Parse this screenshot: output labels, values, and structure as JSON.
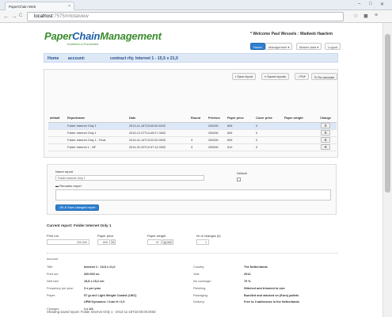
{
  "browser": {
    "tab_title": "PaperChain Web",
    "tab_close": "×",
    "url_host": "localhost",
    "url_path": ":7575/#/totalview",
    "back": "←",
    "forward": "→",
    "reload": "C",
    "win_min": "–",
    "win_max": "□",
    "win_close": "✕",
    "star": "☆",
    "ext": "◼",
    "menu": "≡"
  },
  "header": {
    "logo_paper": "Paper",
    "logo_chain": "Chain",
    "logo_management": "Management",
    "tagline": "Excellence in Procurement",
    "welcome": "* Welcome Paul Wessels : Wadweb Haarlem",
    "nav": {
      "home": "Home",
      "management": "Management ▾",
      "master_data": "Master data ▾",
      "logout": "Logout"
    }
  },
  "breadcrumb": {
    "home": "Home",
    "account": "account:",
    "contract": "contract rfq: Internet 1 - 15,5 x 21,0"
  },
  "actions": {
    "save_report": "Save report",
    "saved_reports": "Saved reports",
    "pdf": "PDF",
    "recalculate": "Re-calculate"
  },
  "reports_table": {
    "columns": [
      "default",
      "Reportname",
      "Date",
      "Round",
      "Printrun",
      "Paper price",
      "Cover price",
      "Paper weight",
      "Change"
    ],
    "rows": [
      {
        "default": "",
        "name": "Folder Internet Only 1",
        "date": "2013-11-18T23:00:00.000Z",
        "round": "",
        "printrun": "200000",
        "paper_price": "605",
        "cover_price": "0",
        "paper_weight": ""
      },
      {
        "default": "",
        "name": "Folder Internet Only 1",
        "date": "2013-12-07T14:45:27.000Z",
        "round": "",
        "printrun": "200000",
        "paper_price": "605",
        "cover_price": "0",
        "paper_weight": ""
      },
      {
        "default": "",
        "name": "Folder Internet Only 1 - Final",
        "date": "2014-01-14T13:22:00.000Z",
        "round": "3",
        "printrun": "200000",
        "paper_price": "605",
        "cover_price": "0",
        "paper_weight": ""
      },
      {
        "default": "",
        "name": "Folder Internet 1 - NF",
        "date": "2014-02-20T10:37:14.000Z",
        "round": "3",
        "printrun": "200000",
        "paper_price": "610",
        "cover_price": "0",
        "paper_weight": ""
      }
    ],
    "change_icon": "⚙"
  },
  "edit_form": {
    "name_label": "Name report",
    "name_value": "Folder Internet Only 1",
    "default_label": "Default",
    "remarks_label": "Remarks report",
    "remarks_value": "",
    "ok_button": "OK & Save changed report"
  },
  "current": {
    "label": "Current report: Folder Internet Only 1",
    "printrun_label": "Print run",
    "printrun_value": "200.000",
    "paper_price_label": "Paper price",
    "paper_price_value": "605",
    "paper_price_unit": "€",
    "paper_weight_label": "Paper weight",
    "paper_weight_value": "57",
    "paper_weight_unit": "gr./m2",
    "changes_label": "Nr of changes (it)",
    "changes_value": "1"
  },
  "details": {
    "account_label": "Account:",
    "left": [
      {
        "k": "Title:",
        "v": "Internet 1 : 15,5 x 21,0"
      },
      {
        "k": "Print run:",
        "v": "200.000 ex."
      },
      {
        "k": "Nett size:",
        "v": "15,8 x 15,2 cm"
      },
      {
        "k": "Frequency per year:",
        "v": "3 x per year"
      },
      {
        "k": "Paper:",
        "v": "57 gr./m2 Light Weight Coated (LWC)"
      },
      {
        "k": "",
        "v": "UPM Kymmene / Cote H / 0,0"
      },
      {
        "k": "Changes :",
        "v": "1  x  4/4"
      }
    ],
    "right": [
      {
        "k": "Country:",
        "v": "The Netherlands"
      },
      {
        "k": "Year:",
        "v": "2014"
      },
      {
        "k": "Ink coverage:",
        "v": "70 %"
      },
      {
        "k": "Finishing:",
        "v": "Stitched and trimmed to size"
      },
      {
        "k": "Packaging:",
        "v": "Bundled and stacked on (Euro) pallets"
      },
      {
        "k": "Delivery:",
        "v": "Free to 3 addresses in the Netherlands"
      }
    ]
  },
  "footer": {
    "saved_text": "Showing saved report: Folder Internet Only 1 - 2013-11-18T23:00:00.000Z"
  }
}
